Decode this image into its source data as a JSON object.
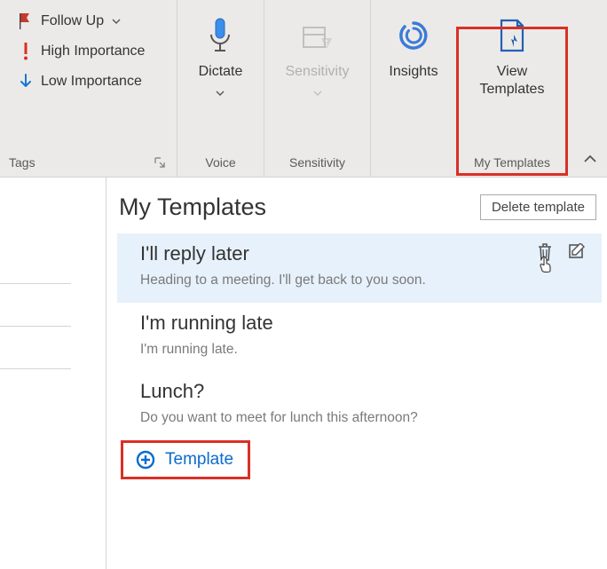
{
  "ribbon": {
    "tags": {
      "followUp": "Follow Up",
      "high": "High Importance",
      "low": "Low Importance",
      "groupLabel": "Tags"
    },
    "voice": {
      "dictate": "Dictate",
      "groupLabel": "Voice"
    },
    "sensitivity": {
      "button": "Sensitivity",
      "groupLabel": "Sensitivity"
    },
    "insights": {
      "button": "Insights"
    },
    "myTemplates": {
      "button1": "View",
      "button2": "Templates",
      "groupLabel": "My Templates"
    }
  },
  "panel": {
    "title": "My Templates",
    "deleteBtn": "Delete template",
    "addTemplate": "Template",
    "items": [
      {
        "title": "I'll reply later",
        "body": "Heading to a meeting. I'll get back to you soon.",
        "active": true
      },
      {
        "title": "I'm running late",
        "body": "I'm running late.",
        "active": false
      },
      {
        "title": "Lunch?",
        "body": "Do you want to meet for lunch this afternoon?",
        "active": false
      }
    ]
  }
}
